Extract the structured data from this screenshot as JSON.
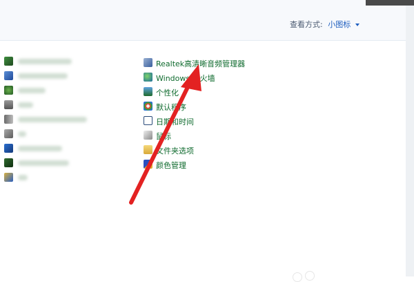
{
  "header": {
    "view_label": "查看方式:",
    "view_value": "小图标"
  },
  "left_items": [
    {
      "icon": "green-monitor-icon"
    },
    {
      "icon": "windows-update-icon"
    },
    {
      "icon": "internet-globe-icon"
    },
    {
      "icon": "keyboard-icon"
    },
    {
      "icon": "speaker-icon"
    },
    {
      "icon": "system-gear-icon"
    },
    {
      "icon": "network-grid-icon"
    },
    {
      "icon": "display-icon"
    },
    {
      "icon": "folder-shield-icon"
    }
  ],
  "items": [
    {
      "label": "Realtek高清晰音频管理器",
      "icon": "audio-manager-icon"
    },
    {
      "label": "Windows 防火墙",
      "icon": "firewall-icon"
    },
    {
      "label": "个性化",
      "icon": "personalization-icon"
    },
    {
      "label": "默认程序",
      "icon": "default-programs-icon"
    },
    {
      "label": "日期和时间",
      "icon": "date-time-icon"
    },
    {
      "label": "鼠标",
      "icon": "mouse-icon"
    },
    {
      "label": "文件夹选项",
      "icon": "folder-options-icon"
    },
    {
      "label": "颜色管理",
      "icon": "color-management-icon"
    }
  ],
  "annotation": {
    "color": "#e32222"
  }
}
